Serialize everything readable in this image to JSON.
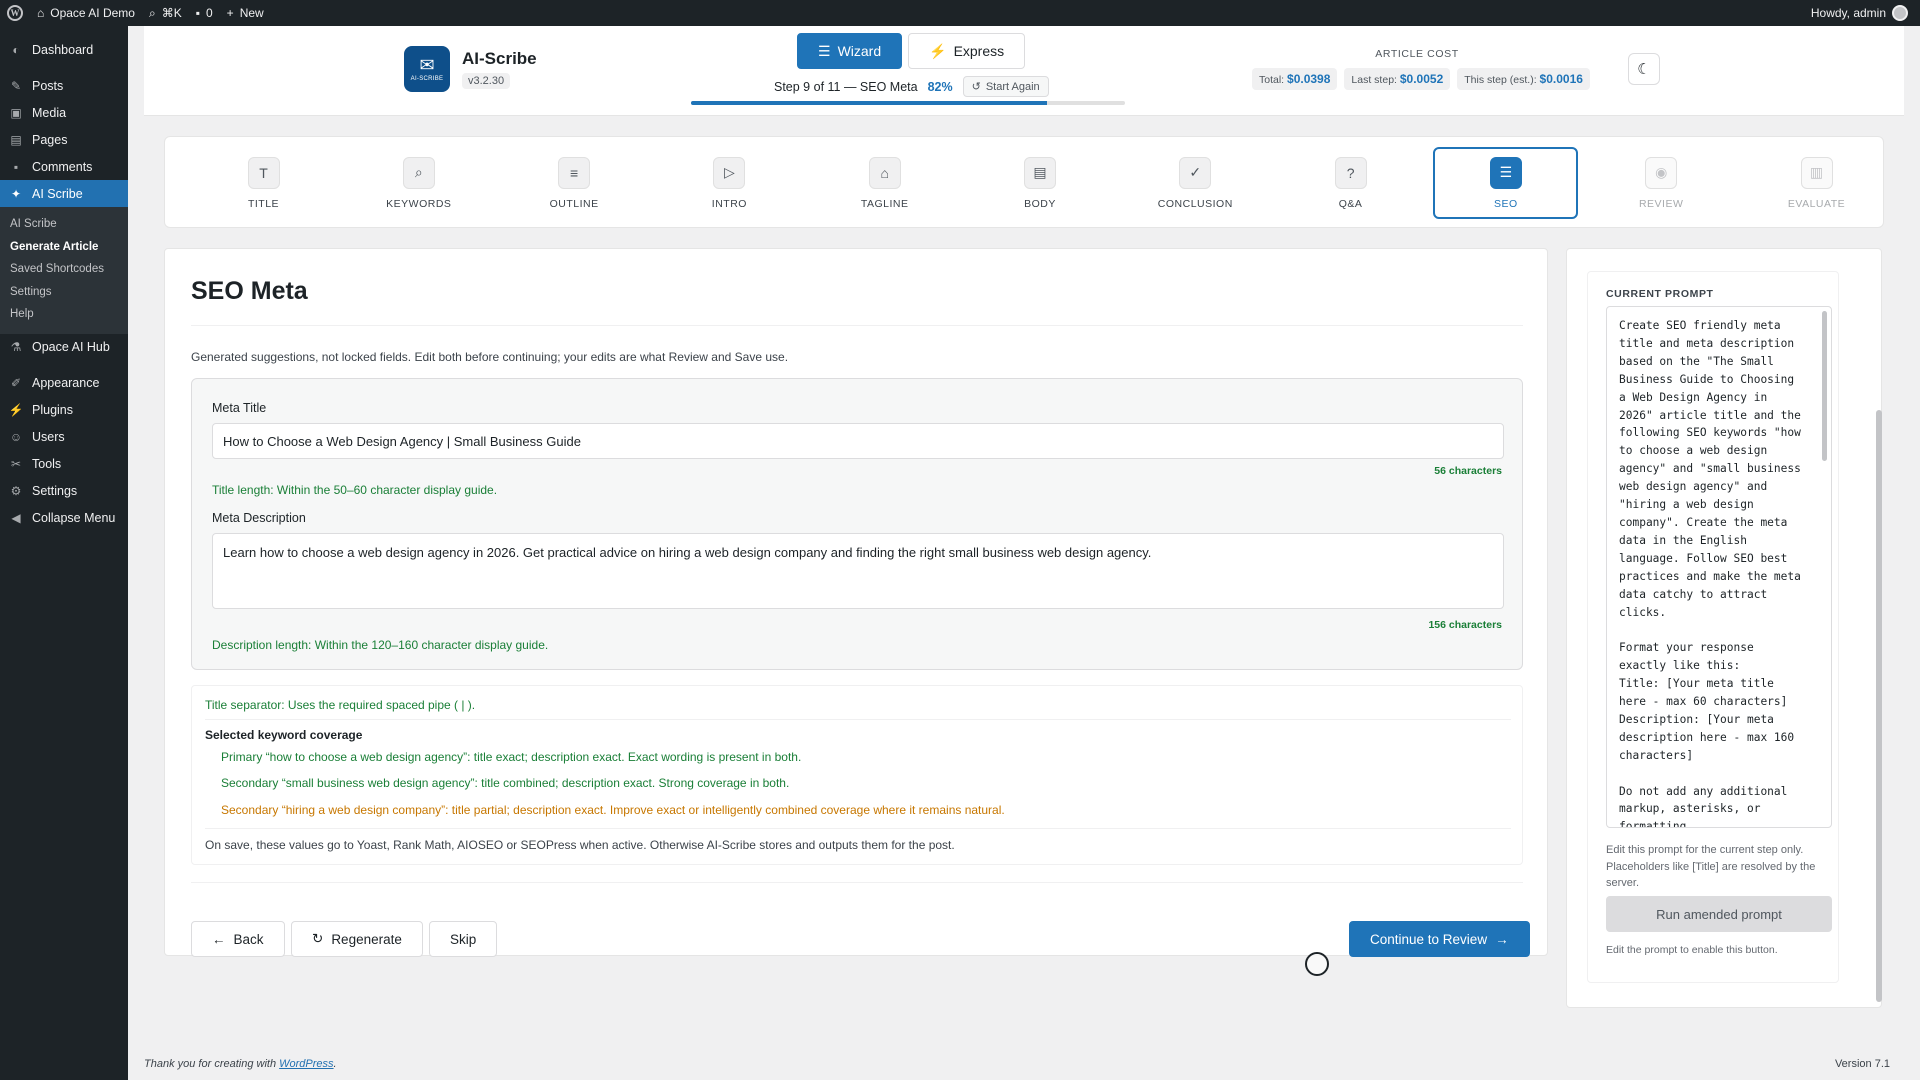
{
  "adminbar": {
    "site_name": "Opace AI Demo",
    "search_shortcut": "⌘K",
    "comments_count": "0",
    "new_label": "New",
    "howdy": "Howdy, admin"
  },
  "sidebar": {
    "items": [
      {
        "label": "Dashboard",
        "icon": "dashboard-icon"
      },
      {
        "label": "Posts",
        "icon": "pin-icon"
      },
      {
        "label": "Media",
        "icon": "media-icon"
      },
      {
        "label": "Pages",
        "icon": "pages-icon"
      },
      {
        "label": "Comments",
        "icon": "comments-icon"
      },
      {
        "label": "AI Scribe",
        "icon": "ai-scribe-icon"
      }
    ],
    "submenu": [
      "AI Scribe",
      "Generate Article",
      "Saved Shortcodes",
      "Settings",
      "Help"
    ],
    "items2": [
      {
        "label": "Opace AI Hub",
        "icon": "hub-icon"
      },
      {
        "label": "Appearance",
        "icon": "appearance-icon"
      },
      {
        "label": "Plugins",
        "icon": "plugins-icon"
      },
      {
        "label": "Users",
        "icon": "users-icon"
      },
      {
        "label": "Tools",
        "icon": "tools-icon"
      },
      {
        "label": "Settings",
        "icon": "settings-icon"
      },
      {
        "label": "Collapse Menu",
        "icon": "collapse-icon"
      }
    ]
  },
  "header": {
    "app_name": "AI-Scribe",
    "version": "v3.2.30",
    "logo_text": "AI-SCRIBE",
    "wizard_label": "Wizard",
    "express_label": "Express",
    "step_text": "Step 9 of 11 — SEO Meta",
    "percent": "82%",
    "progress_fraction": 0.82,
    "start_again": "Start Again",
    "cost_title": "ARTICLE COST",
    "cost_total_label": "Total:",
    "cost_total": "$0.0398",
    "cost_last_label": "Last step:",
    "cost_last": "$0.0052",
    "cost_this_label": "This step (est.):",
    "cost_this": "$0.0016"
  },
  "steps": [
    {
      "label": "TITLE",
      "icon": "title-icon",
      "state": "done"
    },
    {
      "label": "KEYWORDS",
      "icon": "search-icon",
      "state": "done"
    },
    {
      "label": "OUTLINE",
      "icon": "list-icon",
      "state": "done"
    },
    {
      "label": "INTRO",
      "icon": "play-icon",
      "state": "done"
    },
    {
      "label": "TAGLINE",
      "icon": "tag-icon",
      "state": "done"
    },
    {
      "label": "BODY",
      "icon": "document-icon",
      "state": "done"
    },
    {
      "label": "CONCLUSION",
      "icon": "check-circle-icon",
      "state": "done"
    },
    {
      "label": "Q&A",
      "icon": "question-icon",
      "state": "done"
    },
    {
      "label": "SEO",
      "icon": "database-icon",
      "state": "active"
    },
    {
      "label": "REVIEW",
      "icon": "eye-icon",
      "state": "disabled"
    },
    {
      "label": "EVALUATE",
      "icon": "bar-chart-icon",
      "state": "disabled"
    }
  ],
  "seo": {
    "page_title": "SEO Meta",
    "intro": "Generated suggestions, not locked fields. Edit both before continuing; your edits are what Review and Save use.",
    "meta_title_label": "Meta Title",
    "meta_title_value": "How to Choose a Web Design Agency | Small Business Guide",
    "meta_title_count": "56 characters",
    "meta_title_ok": "Title length: Within the 50–60 character display guide.",
    "meta_desc_label": "Meta Description",
    "meta_desc_value": "Learn how to choose a web design agency in 2026. Get practical advice on hiring a web design company and finding the right small business web design agency.",
    "meta_desc_count": "156 characters",
    "meta_desc_ok": "Description length: Within the 120–160 character display guide.",
    "separator_check": "Title separator: Uses the required spaced pipe ( | ).",
    "coverage_heading": "Selected keyword coverage",
    "coverage_primary": "Primary “how to choose a web design agency”: title exact; description exact. Exact wording is present in both.",
    "coverage_secondary_1": "Secondary “small business web design agency”: title combined; description exact. Strong coverage in both.",
    "coverage_secondary_2": "Secondary “hiring a web design company”: title partial; description exact. Improve exact or intelligently combined coverage where it remains natural.",
    "save_note": "On save, these values go to Yoast, Rank Math, AIOSEO or SEOPress when active. Otherwise AI-Scribe stores and outputs them for the post.",
    "back_label": "Back",
    "regenerate_label": "Regenerate",
    "skip_label": "Skip",
    "continue_label": "Continue to Review"
  },
  "prompt": {
    "label": "CURRENT PROMPT",
    "text": "Create SEO friendly meta\ntitle and meta description\nbased on the \"The Small\nBusiness Guide to Choosing\na Web Design Agency in\n2026\" article title and the\nfollowing SEO keywords \"how\nto choose a web design\nagency\" and \"small business\nweb design agency\" and\n\"hiring a web design\ncompany\". Create the meta\ndata in the English\nlanguage. Follow SEO best\npractices and make the meta\ndata catchy to attract\nclicks.\n\nFormat your response\nexactly like this:\nTitle: [Your meta title\nhere - max 60 characters]\nDescription: [Your meta\ndescription here - max 160\ncharacters]\n\nDo not add any additional\nmarkup, asterisks, or\nformatting.",
    "help": "Edit this prompt for the current step only. Placeholders like [Title] are resolved by the server.",
    "run_label": "Run amended prompt",
    "note": "Edit the prompt to enable this button."
  },
  "footer": {
    "thanks_prefix": "Thank you for creating with ",
    "wordpress_link": "WordPress",
    "thanks_suffix": ".",
    "version": "Version 7.1"
  },
  "colors": {
    "accent": "#1f74b8",
    "success": "#1a7f37",
    "warning": "#c77700",
    "admin_dark": "#1d2327"
  }
}
